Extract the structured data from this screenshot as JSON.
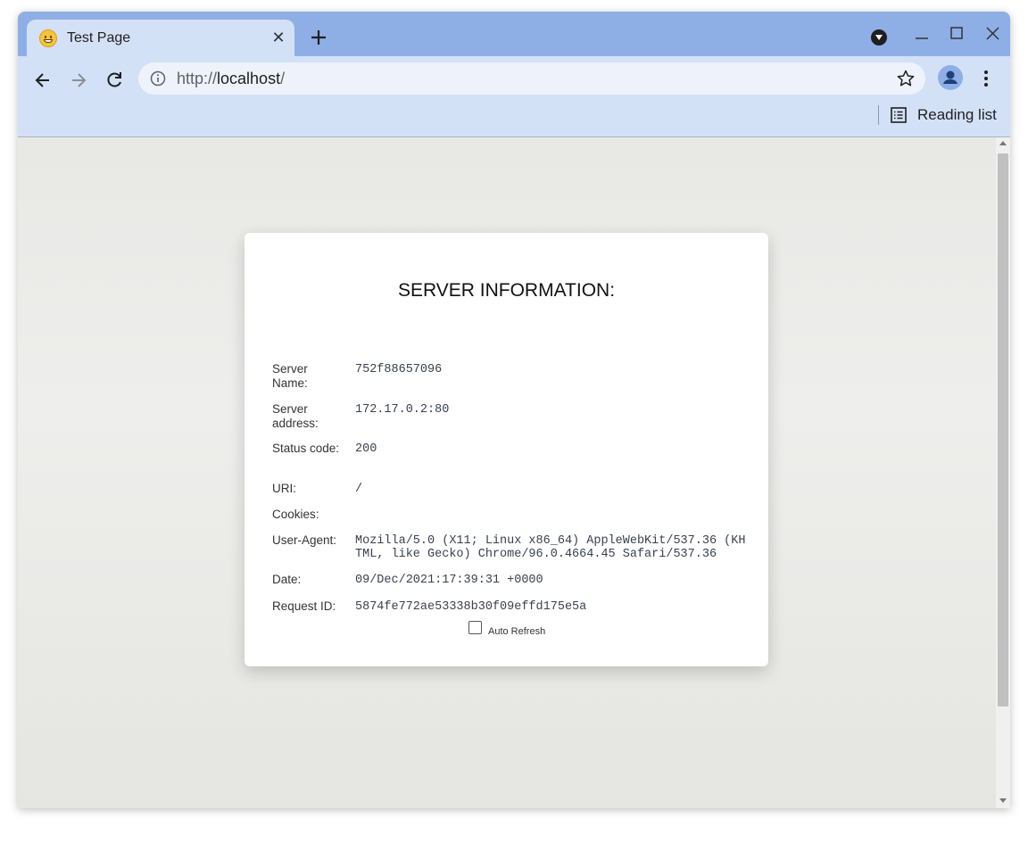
{
  "browser": {
    "tab_title": "Test Page",
    "url_scheme": "http://",
    "url_host": "localhost",
    "url_path": "/",
    "reading_list_label": "Reading list"
  },
  "card": {
    "title": "SERVER INFORMATION:",
    "rows": [
      {
        "key": "Server Name:",
        "value": "752f88657096"
      },
      {
        "key": "Server address:",
        "value": "172.17.0.2:80"
      },
      {
        "key": "Status code:",
        "value": "200"
      },
      {
        "key": "URI:",
        "value": "/"
      },
      {
        "key": "Cookies:",
        "value": ""
      },
      {
        "key": "User-Agent:",
        "value": "Mozilla/5.0 (X11; Linux x86_64) AppleWebKit/537.36 (KHTML, like Gecko) Chrome/96.0.4664.45 Safari/537.36"
      },
      {
        "key": "Date:",
        "value": "09/Dec/2021:17:39:31 +0000"
      },
      {
        "key": "Request ID:",
        "value": "5874fe772ae53338b30f09effd175e5a"
      }
    ],
    "auto_refresh_label": "Auto Refresh"
  },
  "icons": [
    "grinning-face-favicon",
    "close-icon",
    "plus-icon",
    "tab-search-icon",
    "minimize-icon",
    "maximize-icon",
    "close-window-icon",
    "back-arrow-icon",
    "forward-arrow-icon",
    "reload-icon",
    "info-icon",
    "star-icon",
    "account-icon",
    "more-vert-icon",
    "reading-list-icon"
  ],
  "colors": {
    "tabstrip": "#8eaee6",
    "toolbar": "#d3e1f7",
    "page_bg": "#e9e9e6"
  }
}
